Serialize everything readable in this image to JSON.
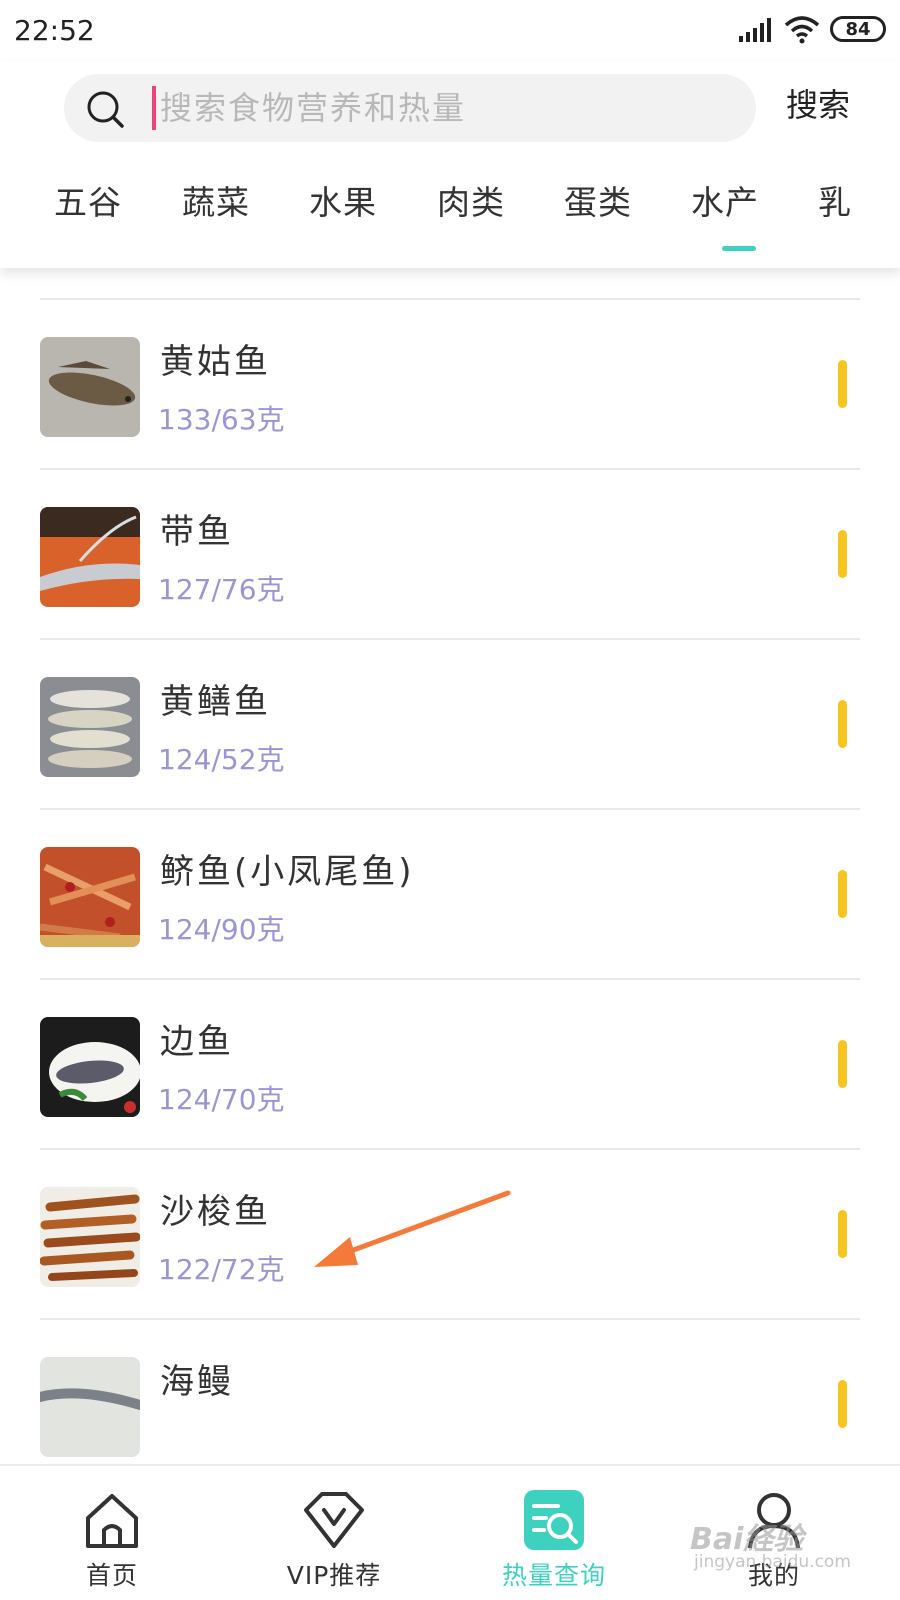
{
  "status_bar": {
    "time": "22:52",
    "battery": "84"
  },
  "search": {
    "placeholder": "搜索食物营养和热量",
    "button_label": "搜索"
  },
  "tabs": [
    {
      "label": "五谷"
    },
    {
      "label": "蔬菜"
    },
    {
      "label": "水果"
    },
    {
      "label": "肉类"
    },
    {
      "label": "蛋类"
    },
    {
      "label": "水产",
      "active": true
    },
    {
      "label": "乳"
    }
  ],
  "foods": [
    {
      "name": "黄姑鱼",
      "calories": "133/63克",
      "thumb": "fish-photo"
    },
    {
      "name": "带鱼",
      "calories": "127/76克",
      "thumb": "hairtail-photo"
    },
    {
      "name": "黄鳝鱼",
      "calories": "124/52克",
      "thumb": "yellow-croaker-photo"
    },
    {
      "name": "鲚鱼(小凤尾鱼)",
      "calories": "124/90克",
      "thumb": "anchovy-photo"
    },
    {
      "name": "边鱼",
      "calories": "124/70克",
      "thumb": "catfish-photo"
    },
    {
      "name": "沙梭鱼",
      "calories": "122/72克",
      "thumb": "fried-fish-photo"
    },
    {
      "name": "海鳗",
      "calories": "",
      "thumb": "eel-photo"
    }
  ],
  "bottom_nav": [
    {
      "label": "首页",
      "icon": "home-icon"
    },
    {
      "label": "VIP推荐",
      "icon": "vip-icon"
    },
    {
      "label": "热量查询",
      "icon": "calorie-search-icon",
      "active": true
    },
    {
      "label": "我的",
      "icon": "profile-icon"
    }
  ],
  "watermark": {
    "main": "Bai経验",
    "sub": "jingyan.baidu.com"
  },
  "colors": {
    "accent": "#3ed1c0",
    "calorie_text": "#9a96d6",
    "bar": "#f7c520",
    "arrow": "#f47a3a",
    "caret": "#e8467a"
  }
}
